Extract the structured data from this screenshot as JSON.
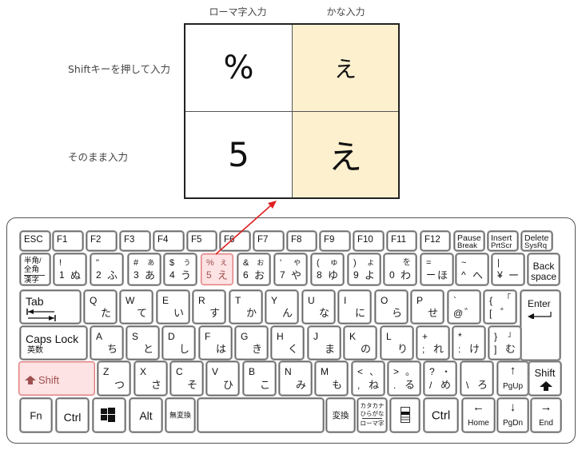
{
  "table": {
    "columns": [
      "ローマ字入力",
      "かな入力"
    ],
    "rows": [
      {
        "label": "Shiftキーを押して入力",
        "romaji": "%",
        "kana": "え"
      },
      {
        "label": "そのまま入力",
        "romaji": "5",
        "kana": "え"
      }
    ]
  },
  "colors": {
    "kana_column_bg": "#fdf0cf",
    "highlight_bg": "#fde3e3",
    "highlight_border": "#e07b7b",
    "arrow": "#e02020"
  },
  "keyboard": {
    "highlighted_keys": [
      "5-key",
      "left-shift"
    ],
    "function_row": [
      "ESC",
      "F1",
      "F2",
      "F3",
      "F4",
      "F5",
      "F6",
      "F7",
      "F8",
      "F9",
      "F10",
      "F11",
      "F12"
    ],
    "pause": {
      "top": "Pause",
      "bottom": "Break"
    },
    "insert": {
      "top": "Insert",
      "bottom": "PrtScr"
    },
    "delete": {
      "top": "Delete",
      "bottom": "SysRq"
    },
    "hankaku": {
      "line1": "半角/",
      "line2": "全角",
      "line3": "漢字"
    },
    "number_row": [
      {
        "shift": "!",
        "shift_kana": "",
        "base": "1",
        "kana": "ぬ"
      },
      {
        "shift": "\"",
        "shift_kana": "",
        "base": "2",
        "kana": "ふ"
      },
      {
        "shift": "#",
        "shift_kana": "ぁ",
        "base": "3",
        "kana": "あ"
      },
      {
        "shift": "$",
        "shift_kana": "ぅ",
        "base": "4",
        "kana": "う"
      },
      {
        "shift": "%",
        "shift_kana": "ぇ",
        "base": "5",
        "kana": "え"
      },
      {
        "shift": "&",
        "shift_kana": "ぉ",
        "base": "6",
        "kana": "お"
      },
      {
        "shift": "'",
        "shift_kana": "ゃ",
        "base": "7",
        "kana": "や"
      },
      {
        "shift": "(",
        "shift_kana": "ゅ",
        "base": "8",
        "kana": "ゆ"
      },
      {
        "shift": ")",
        "shift_kana": "ょ",
        "base": "9",
        "kana": "よ"
      },
      {
        "shift": "",
        "shift_kana": "を",
        "base": "0",
        "kana": "わ"
      },
      {
        "shift": "=",
        "shift_kana": "",
        "base": "ー",
        "kana": "ほ"
      },
      {
        "shift": "~",
        "shift_kana": "",
        "base": "^",
        "kana": "へ"
      },
      {
        "shift": "|",
        "shift_kana": "",
        "base": "¥",
        "kana": "ー"
      }
    ],
    "backspace": {
      "line1": "Back",
      "line2": "space"
    },
    "tab": "Tab",
    "top_row": [
      {
        "letter": "Q",
        "kana": "た"
      },
      {
        "letter": "W",
        "kana": "て"
      },
      {
        "letter": "E",
        "kana": "い"
      },
      {
        "letter": "R",
        "kana": "す"
      },
      {
        "letter": "T",
        "kana": "か"
      },
      {
        "letter": "Y",
        "kana": "ん"
      },
      {
        "letter": "U",
        "kana": "な"
      },
      {
        "letter": "I",
        "kana": "に"
      },
      {
        "letter": "O",
        "kana": "ら"
      },
      {
        "letter": "P",
        "kana": "せ"
      },
      {
        "letter": "`",
        "kana": "゛",
        "base": "@"
      },
      {
        "letter": "{",
        "kana": "゜",
        "base": "[",
        "shift_kana": "「"
      }
    ],
    "enter": "Enter",
    "caps": {
      "label": "Caps Lock",
      "sub": "英数"
    },
    "home_row": [
      {
        "letter": "A",
        "kana": "ち"
      },
      {
        "letter": "S",
        "kana": "と"
      },
      {
        "letter": "D",
        "kana": "し"
      },
      {
        "letter": "F",
        "kana": "は"
      },
      {
        "letter": "G",
        "kana": "き"
      },
      {
        "letter": "H",
        "kana": "く"
      },
      {
        "letter": "J",
        "kana": "ま"
      },
      {
        "letter": "K",
        "kana": "の"
      },
      {
        "letter": "L",
        "kana": "り"
      },
      {
        "letter": "+",
        "kana": "れ",
        "base": ";"
      },
      {
        "letter": "*",
        "kana": "け",
        "base": ":"
      },
      {
        "letter": "}",
        "kana": "む",
        "base": "]",
        "shift_kana": "」"
      }
    ],
    "left_shift": "Shift",
    "bottom_row": [
      {
        "letter": "Z",
        "kana": "つ"
      },
      {
        "letter": "X",
        "kana": "さ"
      },
      {
        "letter": "C",
        "kana": "そ"
      },
      {
        "letter": "V",
        "kana": "ひ"
      },
      {
        "letter": "B",
        "kana": "こ"
      },
      {
        "letter": "N",
        "kana": "み"
      },
      {
        "letter": "M",
        "kana": "も"
      },
      {
        "letter": "<",
        "kana": "ね",
        "base": ",",
        "shift_kana": "、"
      },
      {
        "letter": ">",
        "kana": "る",
        "base": ".",
        "shift_kana": "。"
      },
      {
        "letter": "?",
        "kana": "め",
        "base": "/",
        "shift_kana": "・"
      },
      {
        "letter": "_",
        "kana": "ろ",
        "base": "\\"
      }
    ],
    "pgup": {
      "arrow": "↑",
      "label": "PgUp"
    },
    "right_shift": "Shift",
    "fn": "Fn",
    "ctrl": "Ctrl",
    "alt": "Alt",
    "muhenkan": "無変換",
    "henkan": "変換",
    "katakana": {
      "line1": "カタカナ",
      "line2": "ひらがな",
      "line3": "ローマ字"
    },
    "ctrl_right": "Ctrl",
    "home": {
      "arrow": "←",
      "label": "Home"
    },
    "pgdn": {
      "arrow": "↓",
      "label": "PgDn"
    },
    "end": {
      "arrow": "→",
      "label": "End"
    }
  }
}
